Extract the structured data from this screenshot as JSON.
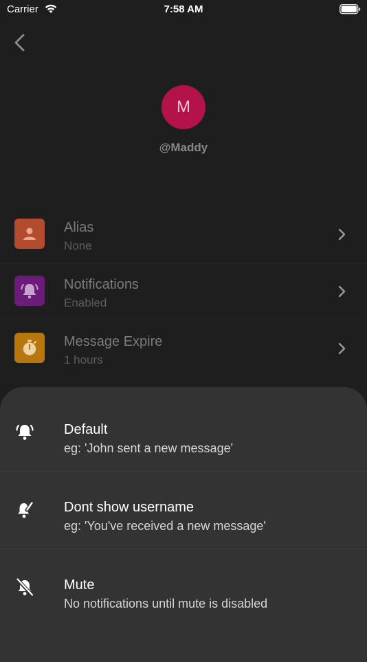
{
  "status_bar": {
    "carrier": "Carrier",
    "time": "7:58 AM"
  },
  "profile": {
    "initial": "M",
    "username": "@Maddy",
    "avatar_color": "#b3134a"
  },
  "settings": [
    {
      "title": "Alias",
      "subtitle": "None",
      "icon": "person-icon",
      "color": "#b34b2e"
    },
    {
      "title": "Notifications",
      "subtitle": "Enabled",
      "icon": "bell-ringing-icon",
      "color": "#6a1c78"
    },
    {
      "title": "Message Expire",
      "subtitle": "1 hours",
      "icon": "timer-icon",
      "color": "#b8760f"
    }
  ],
  "notification_options": [
    {
      "title": "Default",
      "subtitle": "eg: 'John sent a new message'",
      "icon": "bell-ringing-icon"
    },
    {
      "title": "Dont show username",
      "subtitle": "eg: 'You've received a new message'",
      "icon": "bell-edit-icon"
    },
    {
      "title": "Mute",
      "subtitle": "No notifications until mute is disabled",
      "icon": "bell-off-icon"
    }
  ]
}
